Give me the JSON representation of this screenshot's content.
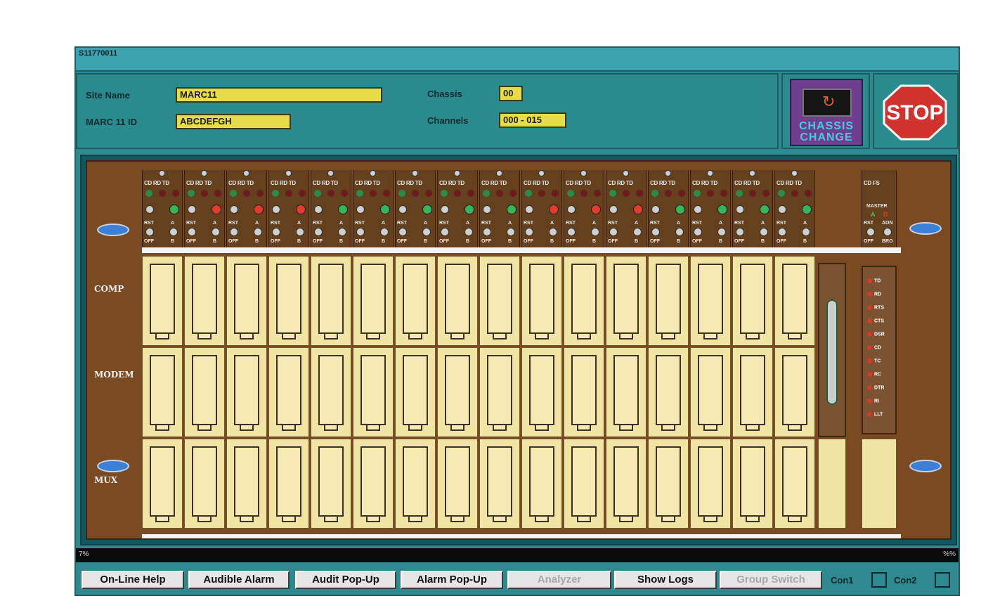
{
  "window": {
    "title": "S11770011"
  },
  "info": {
    "site_name_label": "Site Name",
    "site_name_value": "MARC11",
    "id_label": "MARC 11 ID",
    "id_value": "ABCDEFGH",
    "chassis_label": "Chassis",
    "chassis_value": "00",
    "channels_label": "Channels",
    "channels_value": "000 - 015"
  },
  "chassis_change": {
    "line1": "CHASSIS",
    "line2": "CHANGE"
  },
  "stop": {
    "label": "STOP"
  },
  "rack": {
    "row_labels": [
      "COMP",
      "MODEM",
      "MUX"
    ],
    "card_label": "CD RD TD",
    "rst_label": "RST",
    "ab_label": "A",
    "off_label": "OFF",
    "b_label": "B",
    "status_leds": [
      "green",
      "red",
      "red",
      "red",
      "green",
      "green",
      "green",
      "green",
      "green",
      "red",
      "red",
      "red",
      "green",
      "green",
      "green",
      "green"
    ],
    "master": {
      "top_label": "CD  FS",
      "master_label": "MASTER",
      "a": "A",
      "b": "B",
      "rst": "RST",
      "aon": "AON",
      "off": "OFF",
      "bro": "BRO"
    },
    "signals": [
      "TD",
      "RD",
      "RTS",
      "CTS",
      "DSR",
      "CD",
      "TC",
      "RC",
      "DTR",
      "RI",
      "LLT"
    ]
  },
  "status": {
    "left": "7%",
    "right": "%%"
  },
  "buttons": {
    "online_help": "On-Line Help",
    "audible_alarm": "Audible Alarm",
    "audit_popup": "Audit Pop-Up",
    "alarm_popup": "Alarm Pop-Up",
    "analyzer": "Analyzer",
    "show_logs": "Show Logs",
    "group_switch": "Group Switch",
    "con1": "Con1",
    "con2": "Con2"
  },
  "colors": {
    "panel": "#2e8a90",
    "field": "#e9dc4a",
    "rack": "#7a4a22",
    "bay": "#f2e4a4",
    "purple": "#6e3f8f",
    "stop_red": "#d2322d"
  }
}
